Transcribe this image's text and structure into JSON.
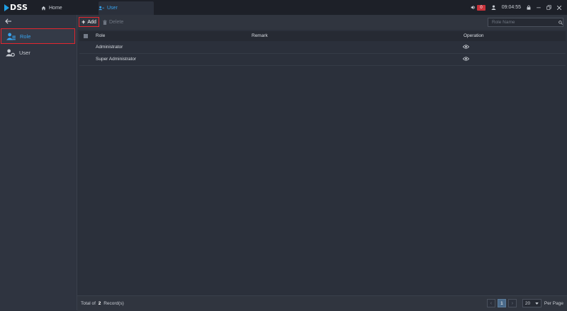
{
  "app": {
    "logo_text": "DSS"
  },
  "tabs": [
    {
      "label": "Home"
    },
    {
      "label": "User"
    }
  ],
  "topbar": {
    "alarm_count": "0",
    "time": "09:04:55"
  },
  "sidebar": {
    "items": [
      {
        "label": "Role"
      },
      {
        "label": "User"
      }
    ]
  },
  "toolbar": {
    "add_label": "Add",
    "delete_label": "Delete",
    "search_placeholder": "Role Name"
  },
  "table": {
    "columns": [
      "Role",
      "Remark",
      "Operation"
    ],
    "rows": [
      {
        "role": "Administrator",
        "remark": ""
      },
      {
        "role": "Super Administrator",
        "remark": ""
      }
    ]
  },
  "footer": {
    "total_prefix": "Total of",
    "total_count": "2",
    "total_suffix": "Record(s)",
    "current_page": "1",
    "page_size": "20",
    "per_page_label": "Per Page"
  },
  "colors": {
    "accent": "#38a3ee",
    "highlight_border": "#e5262e",
    "background": "#2b303b",
    "topbar": "#1d2028"
  }
}
